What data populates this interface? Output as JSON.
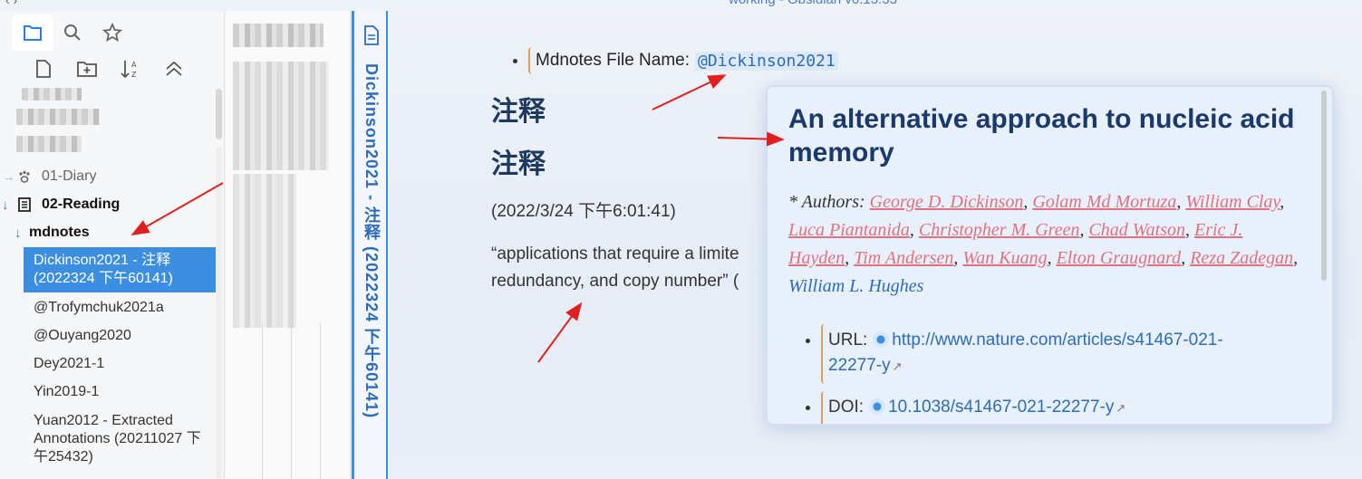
{
  "window": {
    "title": "working - Obsidian v0.13.33",
    "nav": "‹ ›"
  },
  "sidebar": {
    "tabs": [
      {
        "name": "file-explorer",
        "icon": "folder-icon"
      },
      {
        "name": "search",
        "icon": "search-icon"
      },
      {
        "name": "starred",
        "icon": "star-icon"
      }
    ],
    "actions": [
      "new-note-icon",
      "new-folder-icon",
      "sort-icon",
      "collapse-all-icon"
    ],
    "folders": [
      {
        "label": "01-Diary",
        "icon": "paw-icon"
      },
      {
        "label": "02-Reading",
        "icon": "book-icon"
      },
      {
        "label": "mdnotes"
      }
    ],
    "files": [
      "Dickinson2021 - 注释 (2022324 下午60141)",
      "@Trofymchuk2021a",
      "@Ouyang2020",
      "Dey2021-1",
      "Yin2019-1",
      "Yuan2012 - Extracted Annotations (20211027 下午25432)"
    ],
    "active_file_index": 0
  },
  "tab": {
    "title": "Dickinson2021 - 注释 (2022324 下午60141)",
    "icon": "document-icon"
  },
  "note": {
    "mdnotes_label": "Mdnotes File Name:",
    "mdnotes_value": "@Dickinson2021",
    "heading1": "注释",
    "heading2": "注释",
    "date": "(2022/3/24 下午6:01:41)",
    "quote_line1": "“applications that require a limite",
    "quote_line2": "redundancy, and copy number” ("
  },
  "popover": {
    "title": "An alternative approach to nucleic acid memory",
    "authors_label": "* Authors:",
    "authors": [
      "George D. Dickinson",
      "Golam Md Mortuza",
      "William Clay",
      "Luca Piantanida",
      "Christopher M. Green",
      "Chad Watson",
      "Eric J. Hayden",
      "Tim Andersen",
      "Wan Kuang",
      "Elton Graugnard",
      "Reza Zadegan",
      "William L. Hughes"
    ],
    "url_label": "URL:",
    "url": "http://www.nature.com/articles/s41467-021-22277-y",
    "url_line1": "http://www.nature.com/articles/s41467-021-",
    "url_line2": "22277-y",
    "doi_label": "DOI:",
    "doi": "10.1038/s41467-021-22277-y"
  },
  "colors": {
    "accent": "#3b8ee0",
    "author_link": "#e0727f",
    "heading": "#1b3a6b",
    "annotation_arrow": "#e02020"
  }
}
